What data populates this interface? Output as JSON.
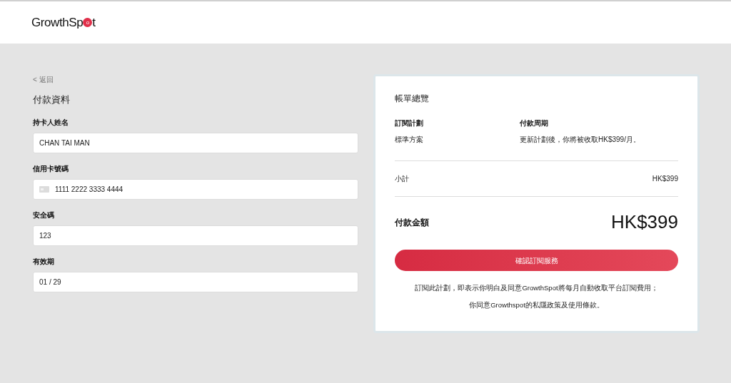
{
  "header": {
    "logo": {
      "start": "GrowthSp",
      "mark": "o",
      "end": "t"
    }
  },
  "payment_form": {
    "back_link": "< 返回",
    "title": "付款資料",
    "fields": [
      {
        "label": "持卡人姓名",
        "value": "CHAN TAI MAN",
        "kind": "text"
      },
      {
        "label": "信用卡號碼",
        "value": "1111 2222 3333 4444",
        "kind": "card"
      },
      {
        "label": "安全碼",
        "value": "123",
        "kind": "text"
      },
      {
        "label": "有效期",
        "value": "01 / 29",
        "kind": "text"
      }
    ]
  },
  "summary": {
    "title": "帳單總覽",
    "plan_label": "訂閱計劃",
    "plan_value": "標準方案",
    "cycle_label": "付款周期",
    "cycle_value": "更新計劃後，你將被收取HK$399/月。",
    "subtotal_label": "小計",
    "subtotal_value": "HK$399",
    "total_label": "付款金額",
    "total_value": "HK$399",
    "confirm_button": "確認訂閱服務",
    "terms": [
      "訂閱此計劃，即表示你明白及同意GrowthSpot將每月自動收取平台訂閱費用；",
      "你同意Growthspot的私隱政策及使用條款。"
    ]
  }
}
